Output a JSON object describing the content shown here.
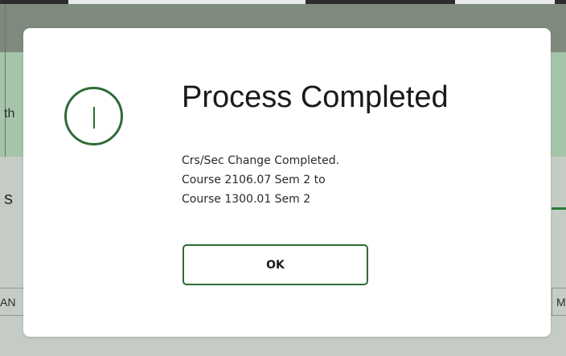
{
  "background": {
    "text_fragment_1": "th",
    "text_fragment_2": "s",
    "text_fragment_3": "AN",
    "text_fragment_4": "M"
  },
  "dialog": {
    "title": "Process Completed",
    "icon": "info-icon",
    "message_lines": [
      "Crs/Sec Change Completed.",
      "Course 2106.07 Sem 2 to",
      "Course 1300.01 Sem 2"
    ],
    "ok_label": "OK"
  },
  "colors": {
    "accent": "#2e6b35",
    "overlay_green": "#a6c4a9"
  }
}
